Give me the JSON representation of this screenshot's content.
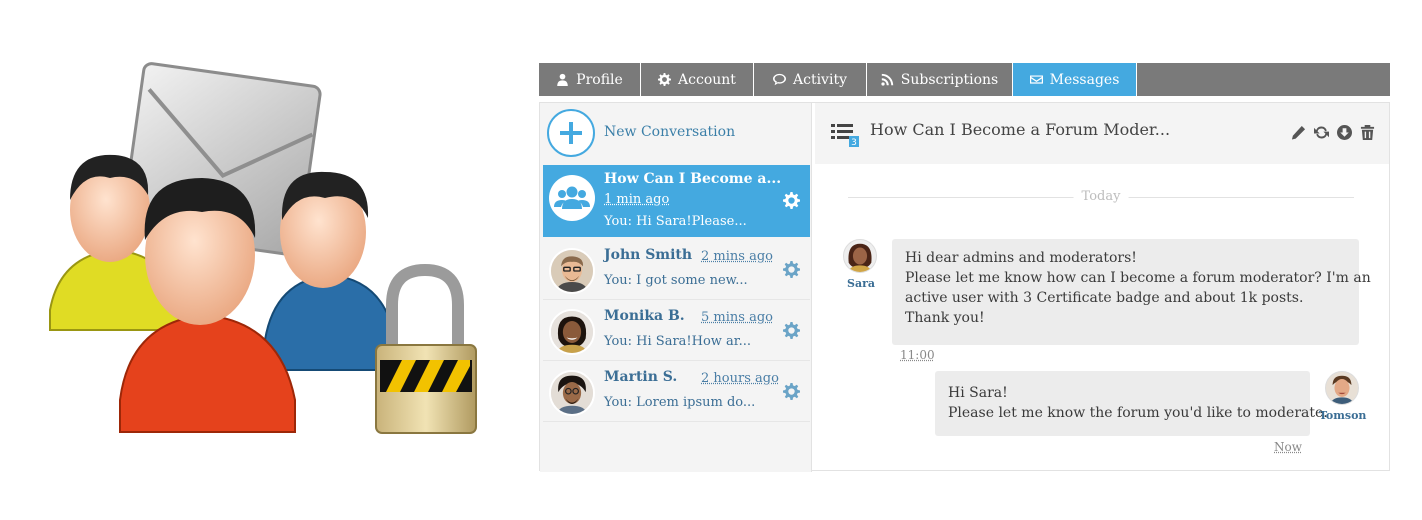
{
  "tabs": [
    {
      "label": "Profile",
      "icon": "user-icon",
      "active": false
    },
    {
      "label": "Account",
      "icon": "gear-icon",
      "active": false
    },
    {
      "label": "Activity",
      "icon": "chat-bubble-icon",
      "active": false
    },
    {
      "label": "Subscriptions",
      "icon": "rss-icon",
      "active": false
    },
    {
      "label": "Messages",
      "icon": "envelope-icon",
      "active": true
    }
  ],
  "sidebar": {
    "new_conversation_label": "New Conversation",
    "conversations": [
      {
        "name": "How Can I Become a...",
        "time": "1 min  ago",
        "preview": "You: Hi Sara!Please...",
        "active": true
      },
      {
        "name": "John Smith",
        "time": "2 mins  ago",
        "preview": "You: I got some new...",
        "active": false
      },
      {
        "name": "Monika B.",
        "time": "5 mins  ago",
        "preview": "You: Hi Sara!How ar...",
        "active": false
      },
      {
        "name": "Martin S.",
        "time": "2 hours  ago",
        "preview": "You: Lorem ipsum do...",
        "active": false
      }
    ]
  },
  "thread": {
    "title": "How Can I Become a Forum Moder...",
    "unread_badge": "3",
    "day_separator": "Today",
    "messages": [
      {
        "user": "Sara",
        "lines": [
          "Hi dear admins and moderators!",
          "Please let me know how can I become a forum moderator? I'm an",
          "active user with 3 Certificate badge and about 1k posts.",
          "Thank you!"
        ],
        "time": "11:00"
      },
      {
        "user": "Tomson",
        "lines": [
          "Hi Sara!",
          "Please let me know the forum you'd like to moderate."
        ],
        "time": "Now"
      }
    ]
  },
  "colors": {
    "accent": "#44a9e0",
    "tab_bar": "#7a7a7a",
    "panel_bg": "#f4f4f4",
    "bubble_bg": "#ececec",
    "name_text": "#3b6e95"
  }
}
